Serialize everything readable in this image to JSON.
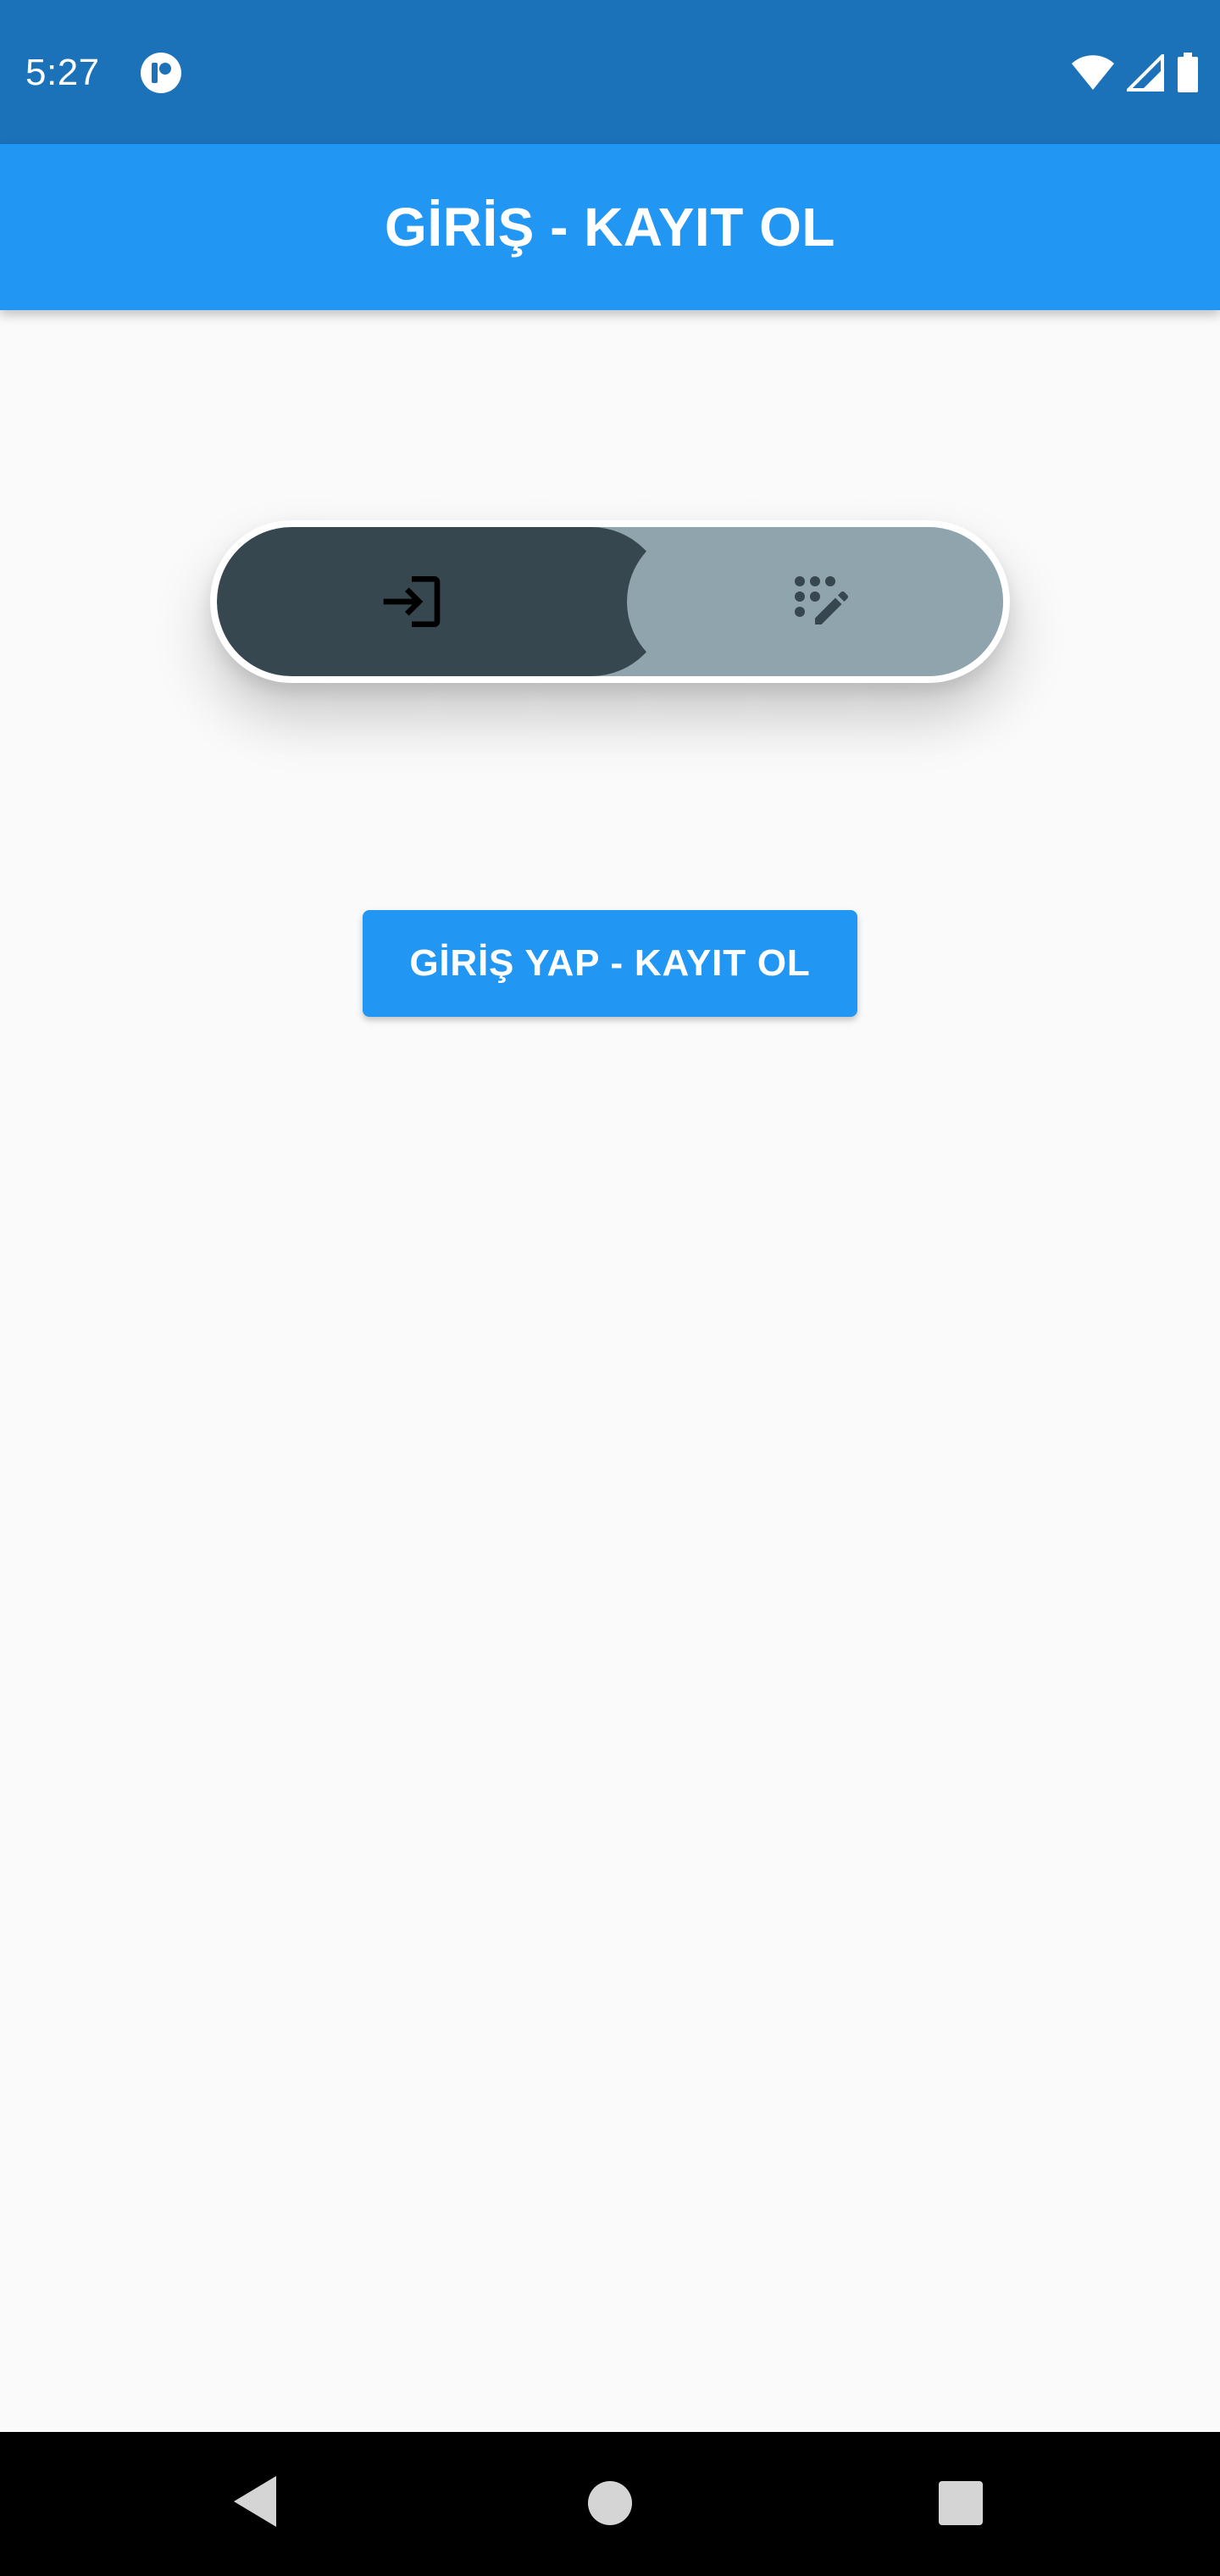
{
  "status_bar": {
    "time": "5:27",
    "app_icon": "notification-app-icon",
    "icons": [
      "wifi-icon",
      "signal-icon",
      "battery-icon"
    ]
  },
  "app_bar": {
    "title": "GİRİŞ - KAYIT OL"
  },
  "toggle": {
    "options": [
      {
        "icon": "login-icon",
        "selected": true
      },
      {
        "icon": "register-icon",
        "selected": false
      }
    ],
    "colors": {
      "selected": "#37474f",
      "unselected": "#90a4ae",
      "border": "#ffffff"
    }
  },
  "main_button": {
    "label": "GİRİŞ YAP - KAYIT OL",
    "color": "#2196f3"
  },
  "nav_bar": {
    "buttons": [
      "back-icon",
      "home-icon",
      "recents-icon"
    ]
  },
  "colors": {
    "status_bar": "#1b72b9",
    "app_bar": "#2196f3",
    "background": "#fafafa"
  }
}
